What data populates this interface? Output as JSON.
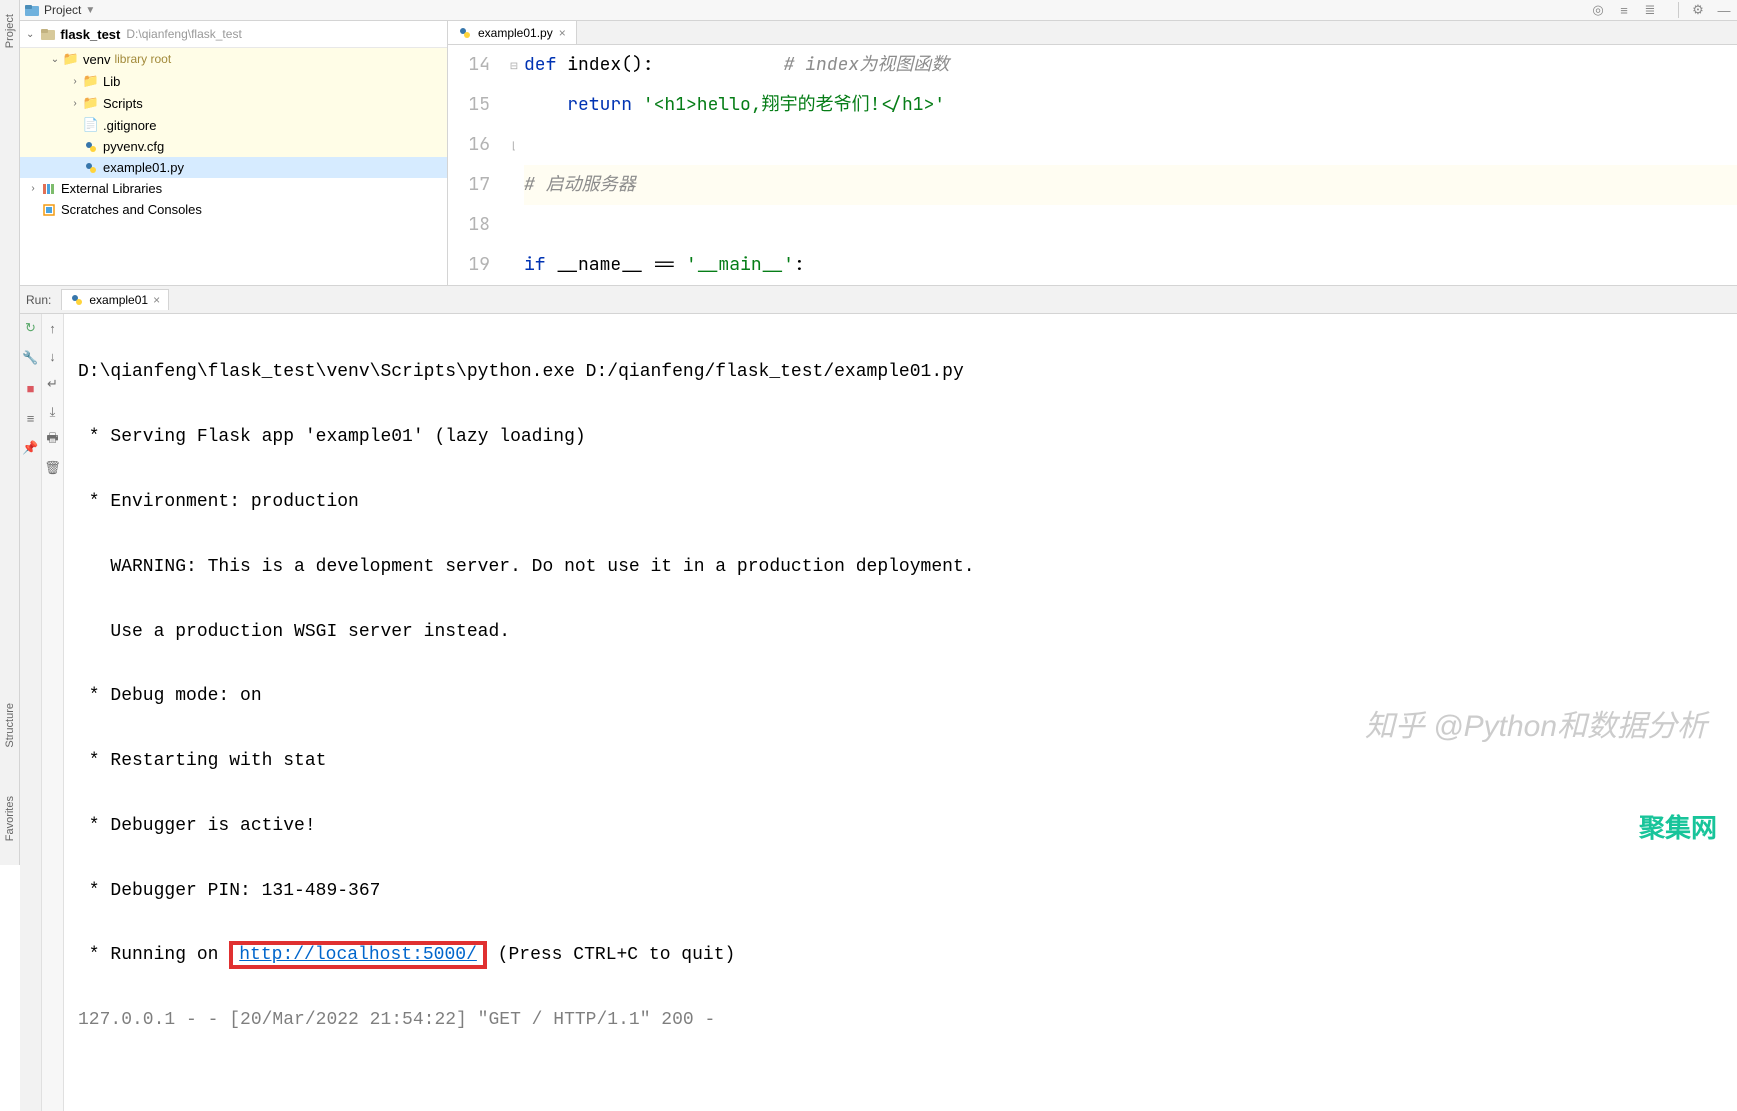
{
  "topbar": {
    "project_label": "Project"
  },
  "left_edge": {
    "project": "Project",
    "structure": "Structure",
    "favorites": "Favorites"
  },
  "tree": {
    "root_name": "flask_test",
    "root_path": "D:\\qianfeng\\flask_test",
    "venv": "venv",
    "venv_hint": "library root",
    "lib": "Lib",
    "scripts": "Scripts",
    "gitignore": ".gitignore",
    "pyvenvcfg": "pyvenv.cfg",
    "example": "example01.py",
    "ext_libs": "External Libraries",
    "scratches": "Scratches and Consoles"
  },
  "editor": {
    "tab": "example01.py",
    "lines": {
      "n14": "14",
      "n15": "15",
      "n16": "16",
      "n17": "17",
      "n18": "18",
      "n19": "19"
    },
    "l14a": "def ",
    "l14b": "index",
    "l14c": "():",
    "l14cmt": "# index为视图函数",
    "l15pad": "    ",
    "l15a": "return ",
    "l15str": "'<h1>hello,翔宇的老爷们!</h1>'",
    "l17cmt": "# 启动服务器",
    "l19a": "if ",
    "l19b": "__name__",
    "l19c": " == ",
    "l19str": "'__main__'",
    "l19d": ":"
  },
  "run": {
    "label": "Run:",
    "tab": "example01",
    "c1": "D:\\qianfeng\\flask_test\\venv\\Scripts\\python.exe D:/qianfeng/flask_test/example01.py",
    "c2": " * Serving Flask app 'example01' (lazy loading)",
    "c3": " * Environment: production",
    "c4": "   WARNING: This is a development server. Do not use it in a production deployment.",
    "c5": "   Use a production WSGI server instead.",
    "c6": " * Debug mode: on",
    "c7": " * Restarting with stat",
    "c8": " * Debugger is active!",
    "c9": " * Debugger PIN: 131-489-367",
    "c10a": " * Running on ",
    "c10url": "http://localhost:5000/",
    "c10b": " (Press CTRL+C to quit)",
    "c11": "127.0.0.1 - - [20/Mar/2022 21:54:22] \"GET / HTTP/1.1\" 200 -"
  },
  "watermark": "知乎 @Python和数据分析",
  "watermark2": "聚集网"
}
